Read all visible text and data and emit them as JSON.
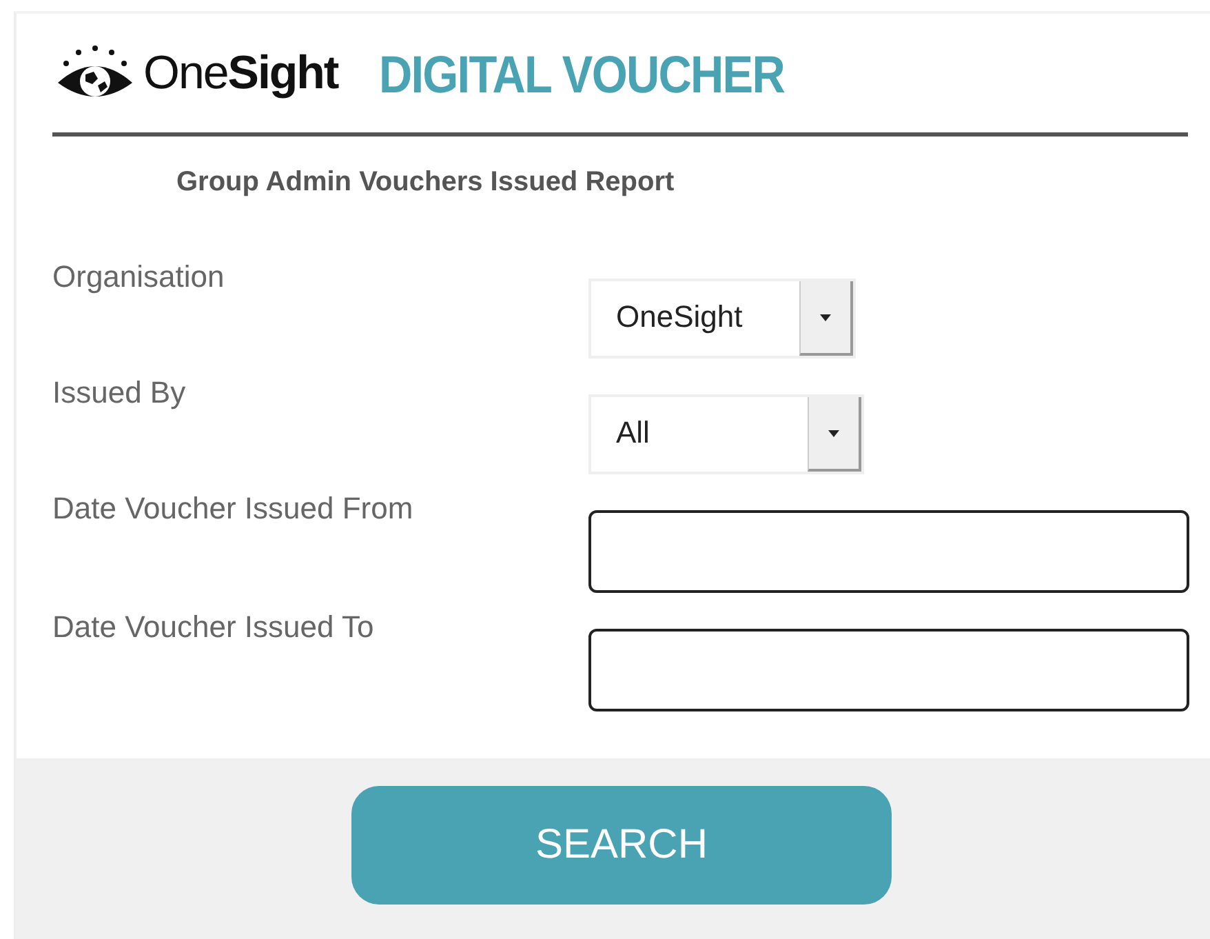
{
  "header": {
    "brand": "One**Sight**",
    "title": "DIGITAL VOUCHER"
  },
  "report_title": "Group Admin Vouchers Issued Report",
  "fields": [
    {
      "kind": "select",
      "label": "Organisation",
      "value": "OneSight"
    },
    {
      "kind": "select",
      "label": "Issued By",
      "value": "All"
    },
    {
      "kind": "text",
      "label": "Date Voucher Issued From"
    },
    {
      "kind": "text",
      "label": "Date Voucher Issued To"
    }
  ],
  "search_button": "SEARCH"
}
